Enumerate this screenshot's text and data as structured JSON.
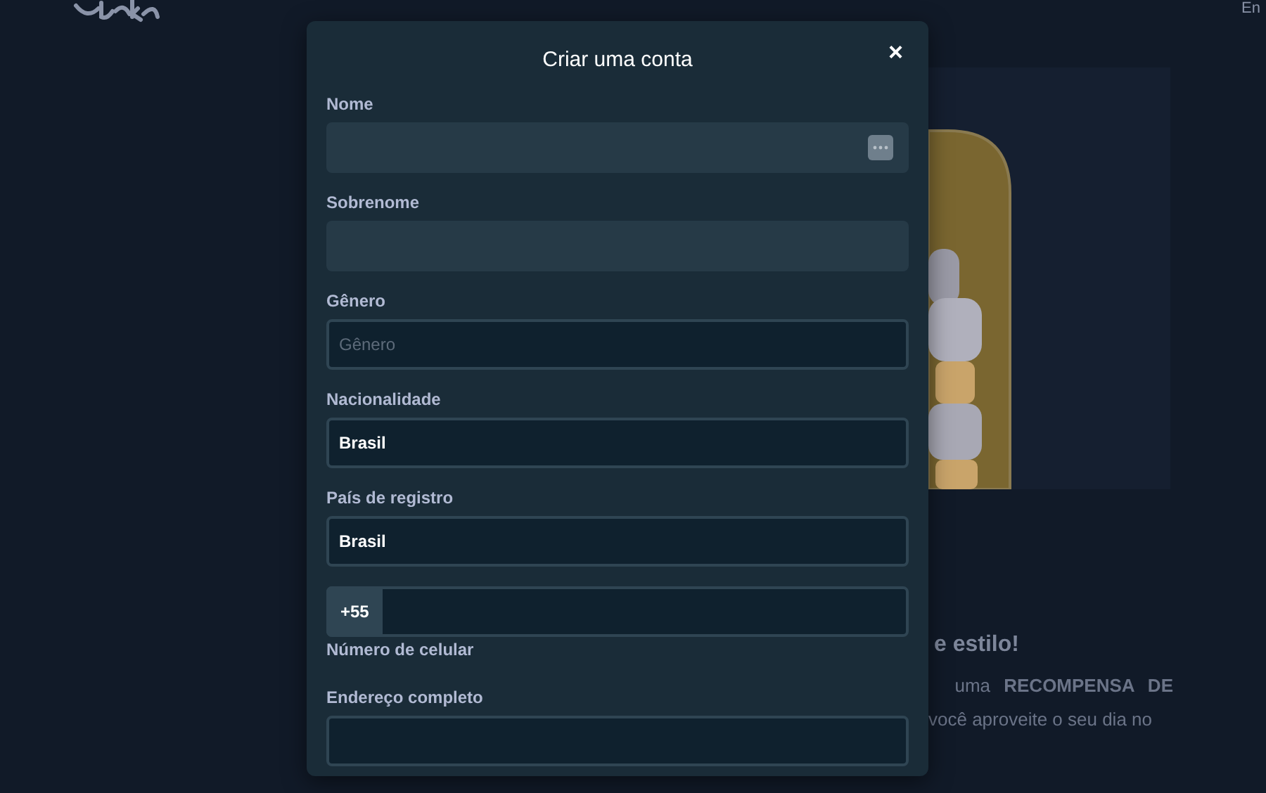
{
  "page": {
    "language": "En",
    "heading_fragment": "e estilo!",
    "paragraph_lines": [
      "uma **RECOMPENSA DE**",
      "você aproveite o seu dia no"
    ]
  },
  "modal": {
    "title": "Criar uma conta",
    "close": "×"
  },
  "fields": [
    {
      "kind": "text",
      "label": "Nome",
      "autofill_icon": true
    },
    {
      "kind": "text",
      "label": "Sobrenome"
    },
    {
      "kind": "select",
      "label": "Gênero",
      "placeholder": "Gênero"
    },
    {
      "kind": "select",
      "label": "Nacionalidade",
      "value": "Brasil"
    },
    {
      "kind": "select",
      "label": "País de registro",
      "value": "Brasil"
    },
    {
      "kind": "phone",
      "prefix": "+55",
      "helper": "Número de celular"
    },
    {
      "kind": "address",
      "label": "Endereço completo"
    }
  ]
}
